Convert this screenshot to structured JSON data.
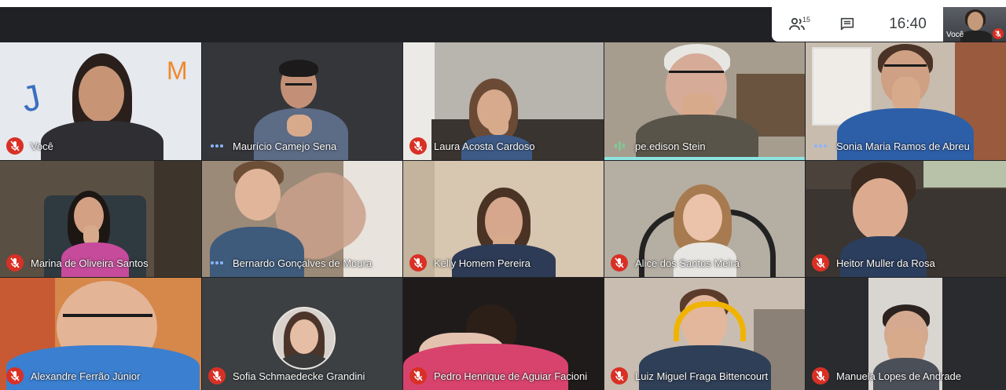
{
  "toolbar": {
    "participants_count": "15",
    "clock": "16:40",
    "self_preview_label": "Você",
    "people_icon": "people-icon",
    "chat_icon": "chat-icon"
  },
  "colors": {
    "background": "#202124",
    "muted_red": "#d93025",
    "dots_blue": "#8ab4f8",
    "active_speaker": "#8ce5e0"
  },
  "participants": [
    {
      "name": "Você",
      "status": "muted"
    },
    {
      "name": "Maurício Camejo Sena",
      "status": "dots"
    },
    {
      "name": "Laura Acosta Cardoso",
      "status": "muted"
    },
    {
      "name": "pe.edison Stein",
      "status": "speaking"
    },
    {
      "name": "Sonia Maria Ramos de Abreu",
      "status": "dots"
    },
    {
      "name": "Marina de Oliveira Santos",
      "status": "muted"
    },
    {
      "name": "Bernardo Gonçalves de Moura",
      "status": "dots"
    },
    {
      "name": "Kelly Homem Pereira",
      "status": "muted"
    },
    {
      "name": "Alice dos Santos Meira",
      "status": "muted"
    },
    {
      "name": "Heitor Muller da Rosa",
      "status": "muted"
    },
    {
      "name": "Alexandre Ferrão Júnior",
      "status": "muted"
    },
    {
      "name": "Sofia Schmaedecke Grandini",
      "status": "muted"
    },
    {
      "name": "Pedro Henrique de Aguiar Facioni",
      "status": "muted"
    },
    {
      "name": "Luiz Miguel Fraga Bittencourt",
      "status": "muted"
    },
    {
      "name": "Manuela Lopes de Andrade",
      "status": "muted"
    }
  ]
}
